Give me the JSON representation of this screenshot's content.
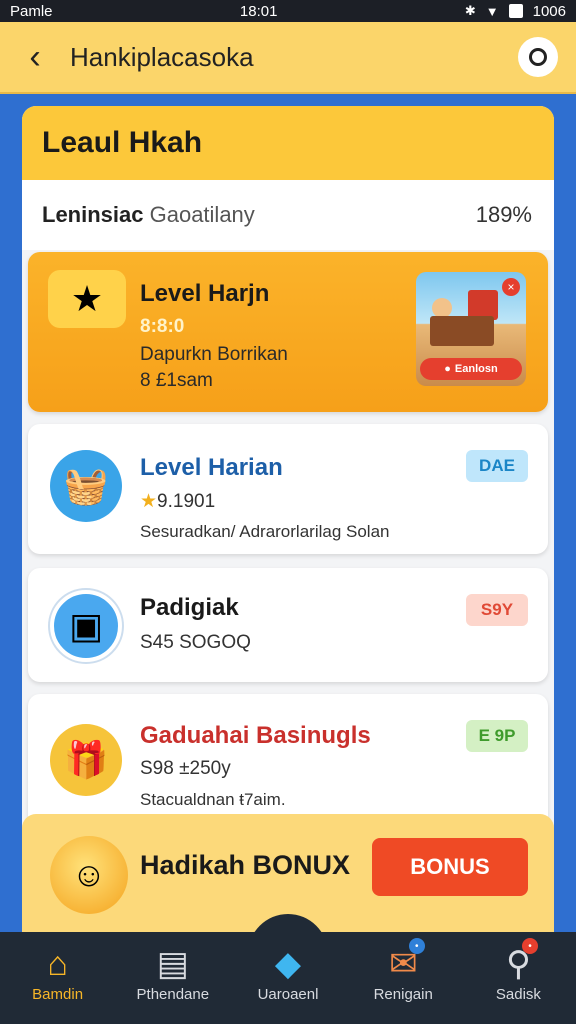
{
  "status_bar": {
    "carrier": "Pamle",
    "time": "18:01",
    "battery": "1006"
  },
  "header": {
    "title": "Hankiplacasoka",
    "back_glyph": "‹"
  },
  "panel": {
    "title": "Leaul Hkah",
    "progress_label_bold": "Leninsiac",
    "progress_label_sub": "Gaoatilany",
    "progress_value": "189%"
  },
  "cards": [
    {
      "title": "Level Harjn",
      "points": "8:8:0",
      "line1": "Dapurkn Borrikan",
      "line2": "8 £1sam",
      "thumb_label": "Eanlosn",
      "thumb_close": "×",
      "colors": {
        "bg": "#f9a825"
      }
    },
    {
      "title": "Level Harian",
      "points": "9.1901",
      "line1": "Sesuradkan/ Adrarorlarilag Solan",
      "badge": "DAE",
      "colors": {
        "title": "#1d5fa8",
        "badge_bg": "#bfe6fb",
        "badge_fg": "#1b86c7"
      }
    },
    {
      "title": "Padigiak",
      "line1": "S45 SOGOQ",
      "badge": "S9Y",
      "colors": {
        "title": "#1a1a1a",
        "badge_bg": "#fdd6cc",
        "badge_fg": "#e04a36"
      }
    },
    {
      "title": "Gaduahai Basinugls",
      "points": "S98 ±250y",
      "line1": "Stacualdnan ŧ7aim.",
      "badge": "E 9P",
      "colors": {
        "title": "#c9302c",
        "badge_bg": "#d4f0c4",
        "badge_fg": "#3f9b2c"
      }
    }
  ],
  "bonus": {
    "title": "Hadikah BONUX",
    "button_label": "BONUS"
  },
  "nav": [
    {
      "label": "Bamdin",
      "icon": "home-icon",
      "active": true
    },
    {
      "label": "Pthendane",
      "icon": "ledger-icon",
      "active": false
    },
    {
      "label": "Uaroaenl",
      "icon": "cube-icon",
      "active": false
    },
    {
      "label": "Renigain",
      "icon": "mail-icon",
      "active": false
    },
    {
      "label": "Sadisk",
      "icon": "search-icon",
      "active": false
    }
  ],
  "accent": "#f7b628"
}
